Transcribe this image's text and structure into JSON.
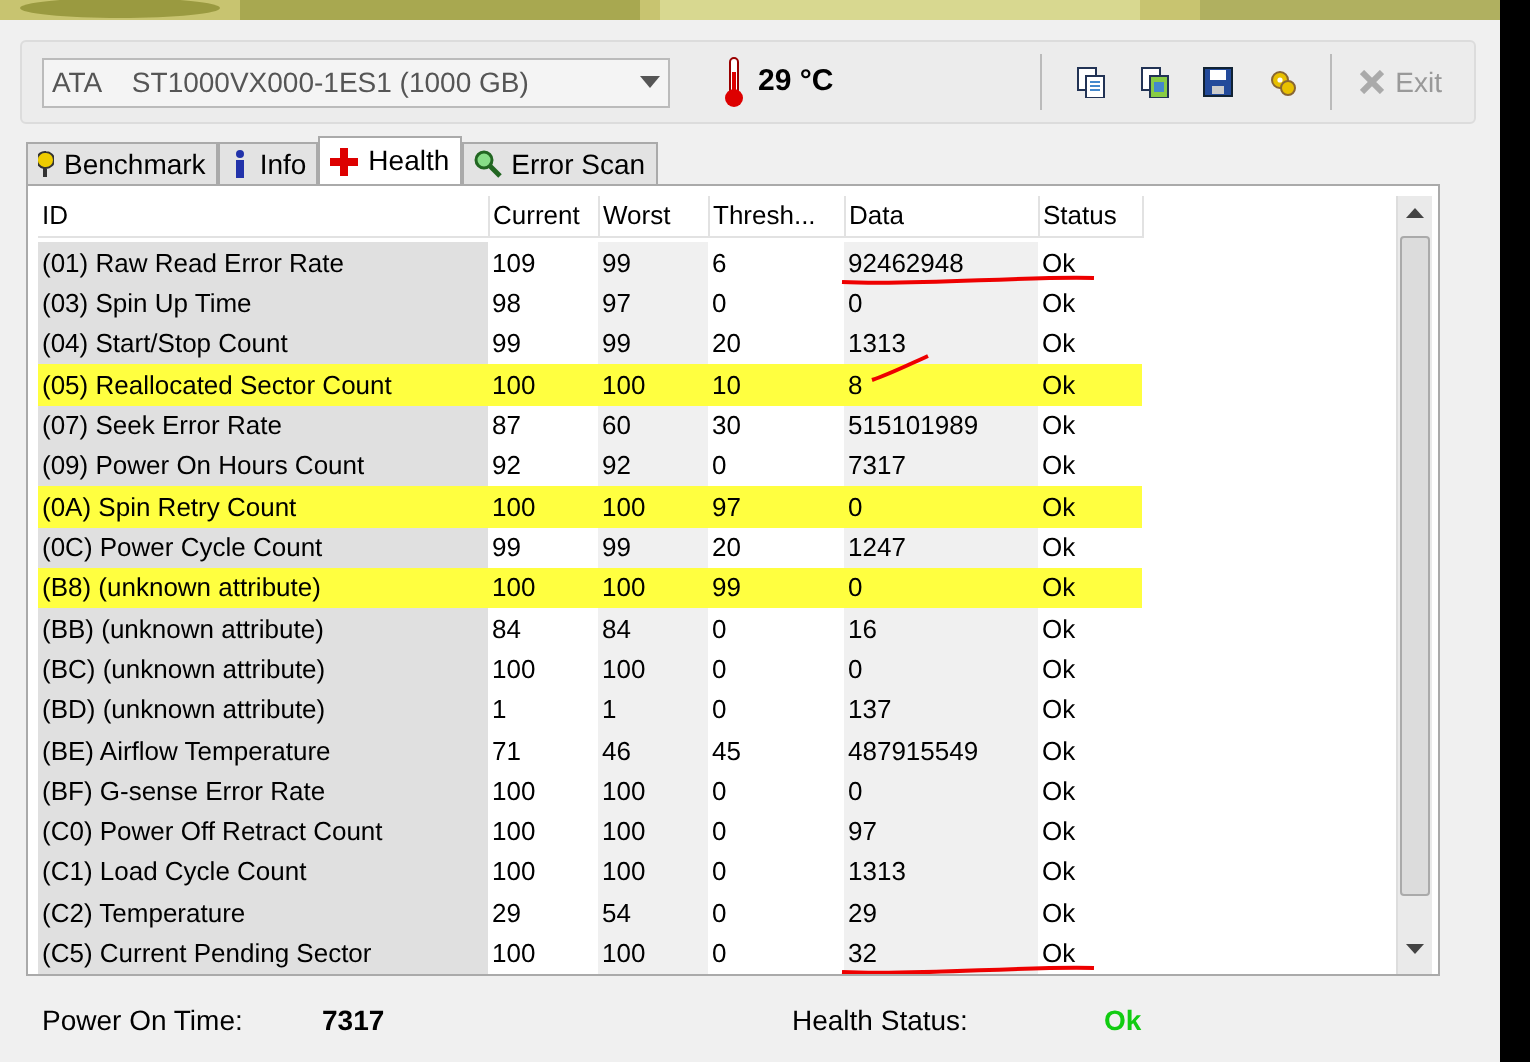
{
  "drive": {
    "value": "ATA    ST1000VX000-1ES1 (1000 GB)"
  },
  "temperature": "29 °C",
  "toolbar": {
    "exit": {
      "label": "Exit",
      "disabled": true
    }
  },
  "tabs": [
    {
      "label": "Benchmark",
      "selected": false,
      "kind": "benchmark"
    },
    {
      "label": "Info",
      "selected": false,
      "kind": "info"
    },
    {
      "label": "Health",
      "selected": true,
      "kind": "health"
    },
    {
      "label": "Error Scan",
      "selected": false,
      "kind": "scan"
    }
  ],
  "table": {
    "columns": [
      "ID",
      "Current",
      "Worst",
      "Thresh...",
      "Data",
      "Status"
    ],
    "rows": [
      {
        "cells": [
          "(01) Raw Read Error Rate",
          "109",
          "99",
          "6",
          "92462948",
          "Ok"
        ],
        "highlighted": false,
        "underlined": true
      },
      {
        "cells": [
          "(03) Spin Up Time",
          "98",
          "97",
          "0",
          "0",
          "Ok"
        ],
        "highlighted": false
      },
      {
        "cells": [
          "(04) Start/Stop Count",
          "99",
          "99",
          "20",
          "1313",
          "Ok"
        ],
        "highlighted": false
      },
      {
        "cells": [
          "(05) Reallocated Sector Count",
          "100",
          "100",
          "10",
          "8",
          "Ok"
        ],
        "highlighted": true,
        "struck": true
      },
      {
        "cells": [
          "(07) Seek Error Rate",
          "87",
          "60",
          "30",
          "515101989",
          "Ok"
        ],
        "highlighted": false
      },
      {
        "cells": [
          "(09) Power On Hours Count",
          "92",
          "92",
          "0",
          "7317",
          "Ok"
        ],
        "highlighted": false
      },
      {
        "cells": [
          "(0A) Spin Retry Count",
          "100",
          "100",
          "97",
          "0",
          "Ok"
        ],
        "highlighted": true
      },
      {
        "cells": [
          "(0C) Power Cycle Count",
          "99",
          "99",
          "20",
          "1247",
          "Ok"
        ],
        "highlighted": false
      },
      {
        "cells": [
          "(B8) (unknown attribute)",
          "100",
          "100",
          "99",
          "0",
          "Ok"
        ],
        "highlighted": true
      },
      {
        "cells": [
          "(BB) (unknown attribute)",
          "84",
          "84",
          "0",
          "16",
          "Ok"
        ],
        "highlighted": false
      },
      {
        "cells": [
          "(BC) (unknown attribute)",
          "100",
          "100",
          "0",
          "0",
          "Ok"
        ],
        "highlighted": false
      },
      {
        "cells": [
          "(BD) (unknown attribute)",
          "1",
          "1",
          "0",
          "137",
          "Ok"
        ],
        "highlighted": false
      },
      {
        "cells": [
          "(BE) Airflow Temperature",
          "71",
          "46",
          "45",
          "487915549",
          "Ok"
        ],
        "highlighted": false
      },
      {
        "cells": [
          "(BF) G-sense Error Rate",
          "100",
          "100",
          "0",
          "0",
          "Ok"
        ],
        "highlighted": false
      },
      {
        "cells": [
          "(C0) Power Off Retract Count",
          "100",
          "100",
          "0",
          "97",
          "Ok"
        ],
        "highlighted": false
      },
      {
        "cells": [
          "(C1) Load Cycle Count",
          "100",
          "100",
          "0",
          "1313",
          "Ok"
        ],
        "highlighted": false
      },
      {
        "cells": [
          "(C2) Temperature",
          "29",
          "54",
          "0",
          "29",
          "Ok"
        ],
        "highlighted": false
      },
      {
        "cells": [
          "(C5) Current Pending Sector",
          "100",
          "100",
          "0",
          "32",
          "Ok"
        ],
        "highlighted": false,
        "underlined": true
      }
    ]
  },
  "footer": {
    "power_on_label": "Power On Time:",
    "power_on_value": "7317",
    "health_label": "Health Status:",
    "health_value": "Ok"
  }
}
